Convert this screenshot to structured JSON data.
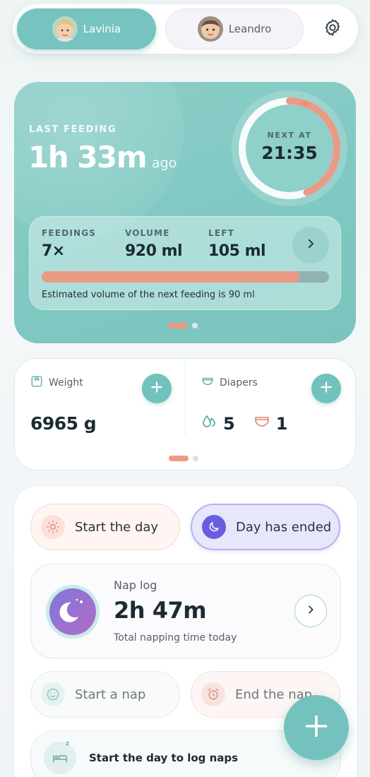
{
  "profiles": [
    {
      "name": "Lavinia",
      "active": true
    },
    {
      "name": "Leandro",
      "active": false
    }
  ],
  "settings": {
    "icon": "gear-icon"
  },
  "feeding": {
    "last_label": "LAST FEEDING",
    "last_value": "1h 33m",
    "last_suffix": "ago",
    "next_label": "NEXT AT",
    "next_time": "21:35",
    "ring_progress": 0.44,
    "stats": {
      "feedings_label": "FEEDINGS",
      "feedings_value": "7×",
      "volume_label": "VOLUME",
      "volume_value": "920 ml",
      "left_label": "LEFT",
      "left_value": "105 ml"
    },
    "volume_progress": 0.9,
    "estimate_text": "Estimated volume of the next feeding is 90 ml"
  },
  "metrics": {
    "weight_label": "Weight",
    "weight_value": "6965 g",
    "diapers_label": "Diapers",
    "wet_count": "5",
    "dirty_count": "1"
  },
  "day": {
    "start_label": "Start the day",
    "end_label": "Day has ended"
  },
  "nap": {
    "label": "Nap log",
    "value": "2h 47m",
    "subtitle": "Total napping time today",
    "start_label": "Start a nap",
    "end_label": "End the nap",
    "banner_text": "Start the day to log naps"
  },
  "colors": {
    "accent_teal": "#76c3bf",
    "accent_coral": "#ea9a85",
    "accent_purple": "#6a5ee0"
  }
}
